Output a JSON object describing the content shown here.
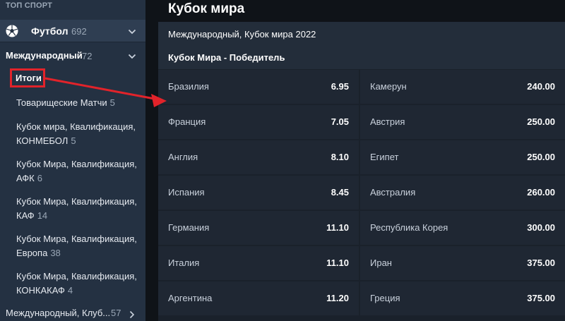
{
  "sidebar": {
    "top_label": "ТОП СПОРТ",
    "sport": {
      "name": "Футбол",
      "count": "692"
    },
    "region": {
      "name": "Международный",
      "count": "72"
    },
    "selected": "Итоги",
    "items": [
      {
        "lines": [
          "Товарищеские Матчи"
        ],
        "count": "5"
      },
      {
        "lines": [
          "Кубок мира, Квалификация,",
          "КОНМЕБОЛ"
        ],
        "count": "5"
      },
      {
        "lines": [
          "Кубок Мира, Квалификация,",
          "АФК"
        ],
        "count": "6"
      },
      {
        "lines": [
          "Кубок Мира, Квалификация,",
          "КАФ"
        ],
        "count": "14"
      },
      {
        "lines": [
          "Кубок Мира, Квалификация,",
          "Европа"
        ],
        "count": "38"
      },
      {
        "lines": [
          "Кубок Мира, Квалификация,",
          "КОНКАКАФ"
        ],
        "count": "4"
      }
    ],
    "bottom": {
      "name": "Международный, Клуб...",
      "count": "57"
    }
  },
  "main": {
    "title": "Кубок мира",
    "event": "Международный, Кубок мира 2022",
    "market": "Кубок Мира - Победитель",
    "odds": [
      [
        {
          "team": "Бразилия",
          "odd": "6.95"
        },
        {
          "team": "Камерун",
          "odd": "240.00"
        }
      ],
      [
        {
          "team": "Франция",
          "odd": "7.05"
        },
        {
          "team": "Австрия",
          "odd": "250.00"
        }
      ],
      [
        {
          "team": "Англия",
          "odd": "8.10"
        },
        {
          "team": "Египет",
          "odd": "250.00"
        }
      ],
      [
        {
          "team": "Испания",
          "odd": "8.45"
        },
        {
          "team": "Австралия",
          "odd": "260.00"
        }
      ],
      [
        {
          "team": "Германия",
          "odd": "11.10"
        },
        {
          "team": "Республика Корея",
          "odd": "300.00"
        }
      ],
      [
        {
          "team": "Италия",
          "odd": "11.10"
        },
        {
          "team": "Иран",
          "odd": "375.00"
        }
      ],
      [
        {
          "team": "Аргентина",
          "odd": "11.20"
        },
        {
          "team": "Греция",
          "odd": "375.00"
        }
      ]
    ]
  },
  "icons": {
    "sport": "soccer-ball-icon",
    "expand": "chevron-down-icon",
    "collapsed": "chevron-right-icon"
  },
  "colors": {
    "highlight": "#e2232a",
    "sidebar_bg": "#243142",
    "panel_bg": "#1f2733"
  }
}
